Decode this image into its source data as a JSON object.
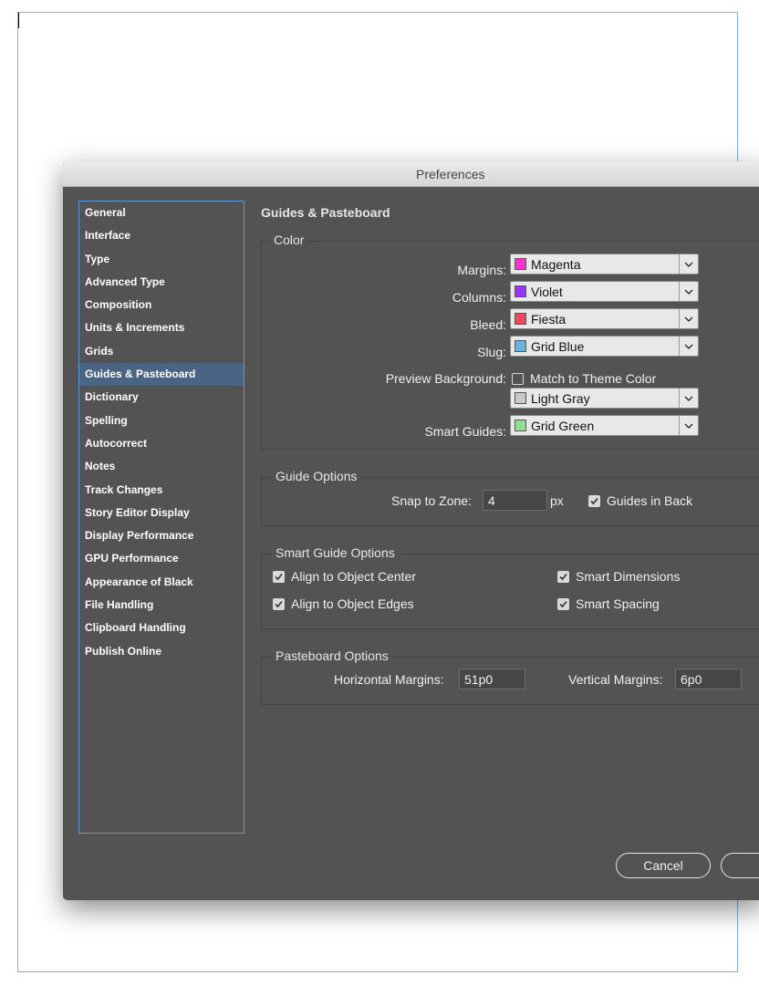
{
  "dialog": {
    "title": "Preferences"
  },
  "categories": [
    {
      "label": "General"
    },
    {
      "label": "Interface"
    },
    {
      "label": "Type"
    },
    {
      "label": "Advanced Type"
    },
    {
      "label": "Composition"
    },
    {
      "label": "Units & Increments"
    },
    {
      "label": "Grids"
    },
    {
      "label": "Guides & Pasteboard"
    },
    {
      "label": "Dictionary"
    },
    {
      "label": "Spelling"
    },
    {
      "label": "Autocorrect"
    },
    {
      "label": "Notes"
    },
    {
      "label": "Track Changes"
    },
    {
      "label": "Story Editor Display"
    },
    {
      "label": "Display Performance"
    },
    {
      "label": "GPU Performance"
    },
    {
      "label": "Appearance of Black"
    },
    {
      "label": "File Handling"
    },
    {
      "label": "Clipboard Handling"
    },
    {
      "label": "Publish Online"
    }
  ],
  "selected_category": "Guides & Pasteboard",
  "section_title": "Guides & Pasteboard",
  "color_group": {
    "title": "Color",
    "margins": {
      "label": "Margins:",
      "value": "Magenta",
      "swatch": "#ff33cc"
    },
    "columns": {
      "label": "Columns:",
      "value": "Violet",
      "swatch": "#9933ff"
    },
    "bleed": {
      "label": "Bleed:",
      "value": "Fiesta",
      "swatch": "#f04a5a"
    },
    "slug": {
      "label": "Slug:",
      "value": "Grid Blue",
      "swatch": "#66b3e0"
    },
    "preview_background": {
      "label": "Preview Background:",
      "checkbox_label": "Match to Theme Color",
      "checked": false,
      "value": "Light Gray",
      "swatch": "#c8c8c8"
    },
    "smart_guides": {
      "label": "Smart Guides:",
      "value": "Grid Green",
      "swatch": "#8fe08f"
    }
  },
  "guide_options": {
    "title": "Guide Options",
    "snap_label": "Snap to Zone:",
    "snap_value": "4",
    "snap_unit": "px",
    "guides_in_back_label": "Guides in Back",
    "guides_in_back_checked": true
  },
  "smart_guide_options": {
    "title": "Smart Guide Options",
    "align_center": "Align to Object Center",
    "align_edges": "Align to Object Edges",
    "smart_dimensions": "Smart Dimensions",
    "smart_spacing": "Smart Spacing"
  },
  "pasteboard_options": {
    "title": "Pasteboard Options",
    "horizontal_label": "Horizontal Margins:",
    "horizontal_value": "51p0",
    "vertical_label": "Vertical Margins:",
    "vertical_value": "6p0"
  },
  "buttons": {
    "cancel": "Cancel"
  },
  "colors": {
    "selected_row": "#4b6484",
    "list_border": "#5b9ad9",
    "dialog_bg": "#535353"
  }
}
